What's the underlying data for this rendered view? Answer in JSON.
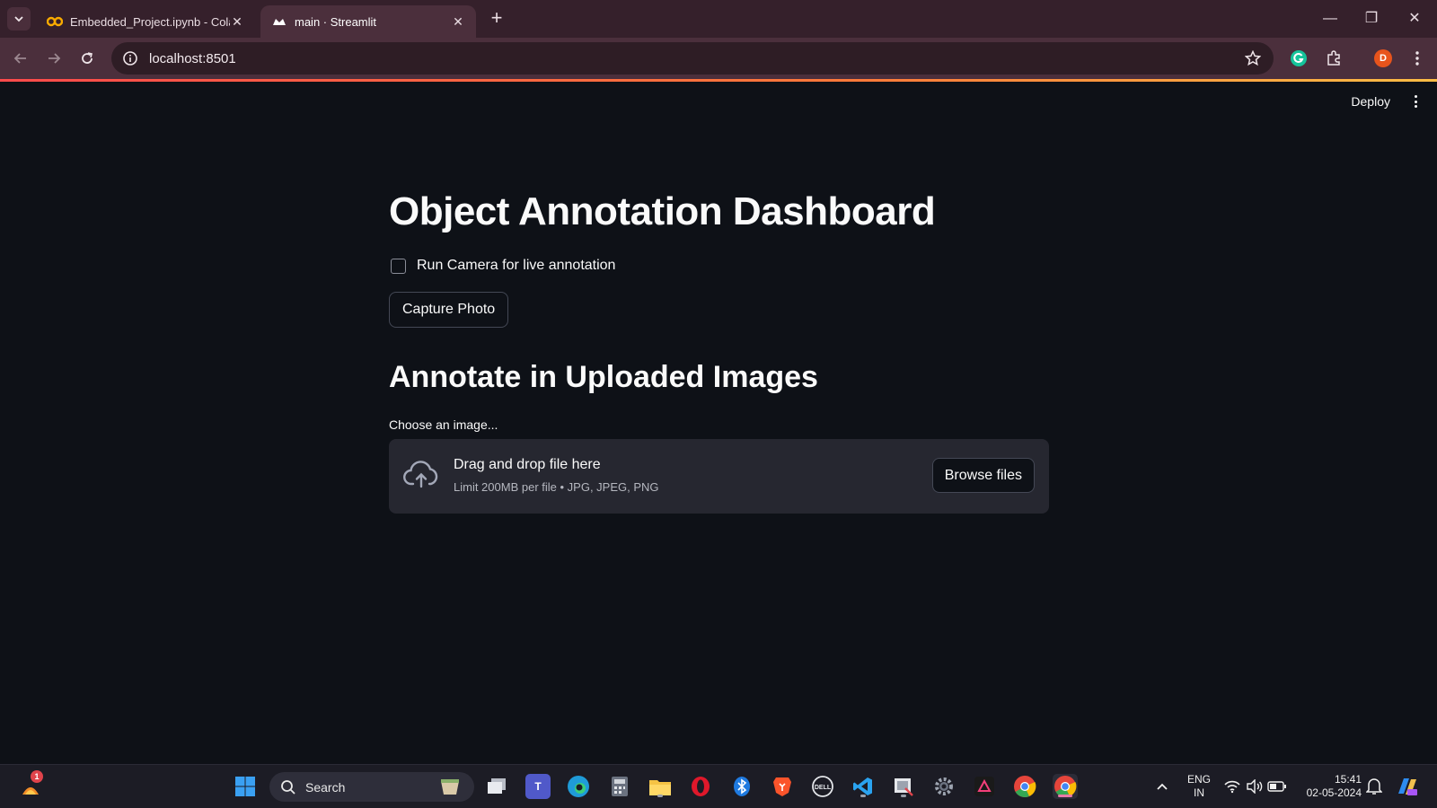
{
  "browser": {
    "tabs": [
      {
        "label": "Embedded_Project.ipynb - Cola",
        "favicon": "colab-icon",
        "active": false
      },
      {
        "label": "main · Streamlit",
        "favicon": "streamlit-icon",
        "active": true
      }
    ],
    "url": "localhost:8501",
    "profile_initial": "D"
  },
  "app": {
    "deploy_label": "Deploy",
    "title": "Object Annotation Dashboard",
    "camera_checkbox_label": "Run Camera for live annotation",
    "camera_checkbox_checked": false,
    "capture_button_label": "Capture Photo",
    "section_heading": "Annotate in Uploaded Images",
    "uploader": {
      "label": "Choose an image...",
      "drop_title": "Drag and drop file here",
      "drop_subtitle": "Limit 200MB per file • JPG, JPEG, PNG",
      "browse_label": "Browse files"
    }
  },
  "taskbar": {
    "search_placeholder": "Search",
    "notification_count": "1",
    "language": "ENG",
    "region": "IN",
    "time": "15:41",
    "date": "02-05-2024"
  },
  "colors": {
    "app_background": "#0e1117",
    "browser_frame": "#35202b",
    "accent": "#ff4b4b",
    "dropzone": "#262730"
  }
}
